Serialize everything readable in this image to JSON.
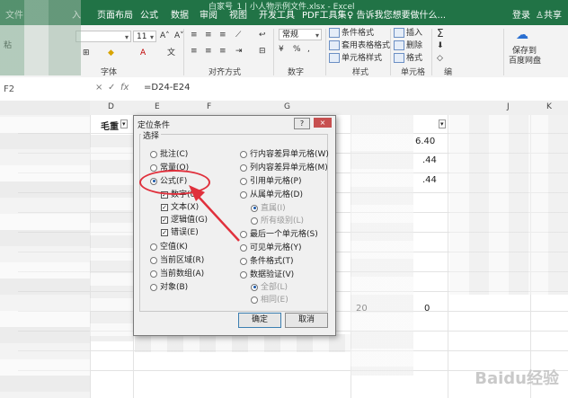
{
  "window": {
    "title": "白家号_1 | 小人物示例文件.xlsx - Excel"
  },
  "ribbon": {
    "tabs": [
      "文件",
      "入",
      "页面布局",
      "公式",
      "数据",
      "审阅",
      "视图",
      "开发工具",
      "PDF工具集"
    ],
    "search_placeholder": "告诉我您想要做什么...",
    "login": "登录",
    "share": "共享",
    "font_name": "",
    "font_size": "11",
    "number_format": "常规",
    "groups": {
      "font": "字体",
      "align": "对齐方式",
      "number": "数字",
      "styles": "样式",
      "cells": "单元格",
      "edit": "编"
    },
    "style_buttons": [
      "条件格式",
      "套用表格格式",
      "单元格样式"
    ],
    "cell_buttons": [
      "插入",
      "删除",
      "格式"
    ],
    "save_to_cloud": [
      "保存到",
      "百度网盘"
    ],
    "paste_label": "粘"
  },
  "formula_bar": {
    "name_box": "F2",
    "cancel": "×",
    "enter": "✓",
    "fx": "fx",
    "formula": "=D24-E24"
  },
  "grid": {
    "columns": [
      "D",
      "E",
      "F",
      "G",
      "J",
      "K"
    ],
    "header_cell": "毛重",
    "values": [
      "6.40",
      ".44",
      ".44",
      "20",
      "0"
    ]
  },
  "dialog": {
    "title": "定位条件",
    "help": "?",
    "close": "×",
    "section": "选择",
    "left_options": [
      {
        "label": "批注(C)",
        "type": "radio",
        "checked": false
      },
      {
        "label": "常量(O)",
        "type": "radio",
        "checked": false
      },
      {
        "label": "公式(F)",
        "type": "radio",
        "checked": true
      },
      {
        "label": "数字(U)",
        "type": "check",
        "checked": true
      },
      {
        "label": "文本(X)",
        "type": "check",
        "checked": true
      },
      {
        "label": "逻辑值(G)",
        "type": "check",
        "checked": true
      },
      {
        "label": "错误(E)",
        "type": "check",
        "checked": true
      },
      {
        "label": "空值(K)",
        "type": "radio",
        "checked": false
      },
      {
        "label": "当前区域(R)",
        "type": "radio",
        "checked": false
      },
      {
        "label": "当前数组(A)",
        "type": "radio",
        "checked": false
      },
      {
        "label": "对象(B)",
        "type": "radio",
        "checked": false
      }
    ],
    "right_options": [
      {
        "label": "行内容差异单元格(W)",
        "type": "radio",
        "checked": false,
        "dim": false
      },
      {
        "label": "列内容差异单元格(M)",
        "type": "radio",
        "checked": false,
        "dim": false
      },
      {
        "label": "引用单元格(P)",
        "type": "radio",
        "checked": false,
        "dim": false
      },
      {
        "label": "从属单元格(D)",
        "type": "radio",
        "checked": false,
        "dim": false
      },
      {
        "label": "直属(I)",
        "type": "radio",
        "checked": true,
        "dim": true
      },
      {
        "label": "所有级别(L)",
        "type": "radio",
        "checked": false,
        "dim": true
      },
      {
        "label": "最后一个单元格(S)",
        "type": "radio",
        "checked": false,
        "dim": false
      },
      {
        "label": "可见单元格(Y)",
        "type": "radio",
        "checked": false,
        "dim": false
      },
      {
        "label": "条件格式(T)",
        "type": "radio",
        "checked": false,
        "dim": false
      },
      {
        "label": "数据验证(V)",
        "type": "radio",
        "checked": false,
        "dim": false
      },
      {
        "label": "全部(L)",
        "type": "radio",
        "checked": true,
        "dim": true
      },
      {
        "label": "相同(E)",
        "type": "radio",
        "checked": false,
        "dim": true
      }
    ],
    "ok": "确定",
    "cancel": "取消"
  },
  "watermark": "Baidu经验",
  "colors": {
    "excel_green": "#217346",
    "annotation_red": "#e0303c"
  }
}
